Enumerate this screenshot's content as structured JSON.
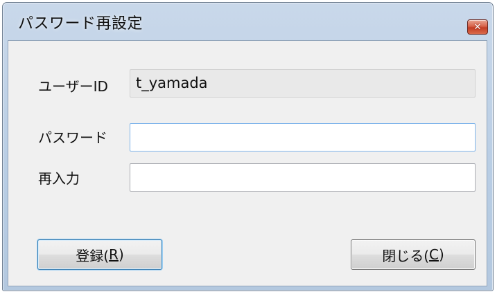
{
  "window": {
    "title": "パスワード再設定",
    "close_icon": "close-icon"
  },
  "form": {
    "userid_label": "ユーザーID",
    "userid_value": "t_yamada",
    "password_label": "パスワード",
    "password_value": "",
    "reenter_label": "再入力",
    "reenter_value": ""
  },
  "buttons": {
    "register_label": "登録(",
    "register_mnemonic": "R",
    "register_close": ")",
    "close_label": "閉じる(",
    "close_mnemonic": "C",
    "close_close": ")"
  },
  "colors": {
    "titlebar": "#b8cde4",
    "client_bg": "#f0f0f0",
    "close_button": "#c33d24",
    "focus_border": "#7eb4ea"
  }
}
